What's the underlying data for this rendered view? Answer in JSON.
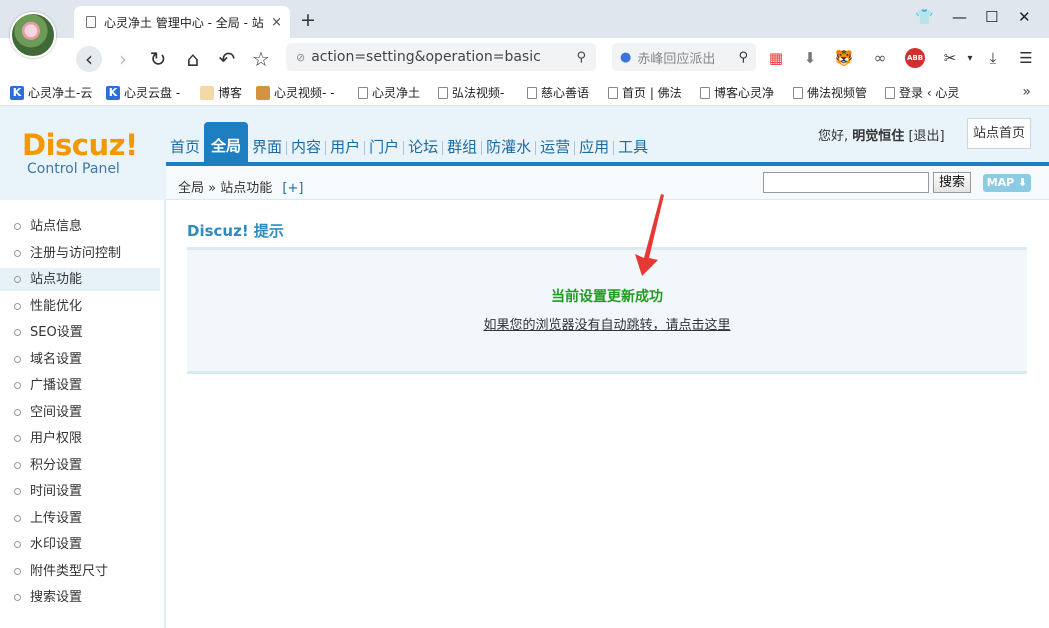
{
  "browser": {
    "tab_title": "心灵净土 管理中心 - 全局 - 站",
    "tab_close": "×",
    "new_tab": "+",
    "url": "action=setting&operation=basic",
    "search_placeholder": "赤峰回应派出",
    "bookmarks": [
      {
        "label": "心灵净土-云",
        "icon": "k"
      },
      {
        "label": "心灵云盘 -",
        "icon": "k"
      },
      {
        "label": "博客",
        "icon": "img"
      },
      {
        "label": "心灵视频- -",
        "icon": "img2"
      },
      {
        "label": "心灵净土",
        "icon": "doc"
      },
      {
        "label": "弘法视频-",
        "icon": "doc"
      },
      {
        "label": "慈心善语",
        "icon": "doc"
      },
      {
        "label": "首页 | 佛法",
        "icon": "doc"
      },
      {
        "label": "博客心灵净",
        "icon": "doc"
      },
      {
        "label": "佛法视频管",
        "icon": "doc"
      },
      {
        "label": "登录 ‹ 心灵",
        "icon": "doc"
      }
    ],
    "bookmarks_more": "»"
  },
  "admin": {
    "logo": {
      "brand": "Discuz!",
      "sub": "Control Panel"
    },
    "nav": [
      "首页",
      "全局",
      "界面",
      "内容",
      "用户",
      "门户",
      "论坛",
      "群组",
      "防灌水",
      "运营",
      "应用",
      "工具"
    ],
    "nav_active_index": 1,
    "user": {
      "greeting": "您好,",
      "name": "明觉恒住",
      "logout": "[退出]"
    },
    "site_home": "站点首页",
    "breadcrumb": {
      "section": "全局",
      "sep": "»",
      "page": "站点功能",
      "plus": "[+]"
    },
    "search": {
      "button": "搜索",
      "value": ""
    },
    "map_button": "MAP ⬇",
    "sidebar": [
      "站点信息",
      "注册与访问控制",
      "站点功能",
      "性能优化",
      "SEO设置",
      "域名设置",
      "广播设置",
      "空间设置",
      "用户权限",
      "积分设置",
      "时间设置",
      "上传设置",
      "水印设置",
      "附件类型尺寸",
      "搜索设置"
    ],
    "sidebar_active_index": 2,
    "content_title": "Discuz! 提示",
    "message": "当前设置更新成功",
    "redirect_link": "如果您的浏览器没有自动跳转，请点击这里"
  },
  "colors": {
    "accent": "#1d7fbf",
    "success": "#219b21",
    "logo": "#f39800",
    "annotation_arrow": "#e53935"
  }
}
